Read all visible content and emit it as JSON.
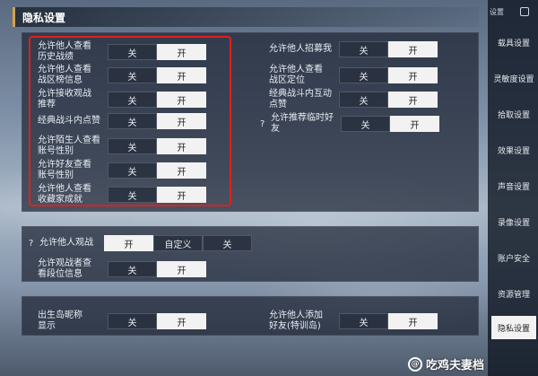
{
  "title": "隐私设置",
  "sidebar": {
    "header_label": "设置",
    "items": [
      {
        "label": "载具设置"
      },
      {
        "label": "灵敏度设置"
      },
      {
        "label": "拾取设置"
      },
      {
        "label": "效果设置"
      },
      {
        "label": "声音设置"
      },
      {
        "label": "录像设置"
      },
      {
        "label": "账户安全"
      },
      {
        "label": "资源管理"
      },
      {
        "label": "隐私设置",
        "active": true
      }
    ]
  },
  "toggle_labels": {
    "off": "关",
    "on": "开",
    "custom": "自定义"
  },
  "left_settings": [
    {
      "label": "允许他人查看历史战绩",
      "line1": "允许他人查看",
      "line2": "历史战绩",
      "value": "on"
    },
    {
      "label": "允许他人查看战区榜信息",
      "line1": "允许他人查看",
      "line2": "战区榜信息",
      "value": "on"
    },
    {
      "label": "允许接收观战推荐",
      "line1": "允许接收观战",
      "line2": "推荐",
      "value": "on"
    },
    {
      "label": "经典战斗内点赞",
      "line1": "经典战斗内点赞",
      "line2": "",
      "value": "on"
    },
    {
      "label": "允许陌生人查看账号性别",
      "line1": "允许陌生人查看",
      "line2": "账号性别",
      "value": "on"
    },
    {
      "label": "允许好友查看账号性别",
      "line1": "允许好友查看",
      "line2": "账号性别",
      "value": "on"
    },
    {
      "label": "允许他人查看收藏家成就",
      "line1": "允许他人查看",
      "line2": "收藏家成就",
      "value": "on"
    }
  ],
  "right_settings": [
    {
      "line1": "允许他人招募我",
      "line2": "",
      "value": "on"
    },
    {
      "line1": "允许他人查看",
      "line2": "战区定位",
      "value": "on"
    },
    {
      "line1": "经典战斗内互动",
      "line2": "点赞",
      "value": "on"
    },
    {
      "line1": "允许推荐临时好",
      "line2": "友",
      "value": "on",
      "help": "?"
    }
  ],
  "spectate": {
    "help": "?",
    "label": "允许他人观战",
    "options": [
      "开",
      "自定义",
      "关"
    ],
    "selected": "开"
  },
  "spectator_rank": {
    "line1": "允许观战者查",
    "line2": "看段位信息",
    "value": "on"
  },
  "birth_island": {
    "line1": "出生岛昵称",
    "line2": "显示",
    "value": "on"
  },
  "add_friend": {
    "line1": "允许他人添加",
    "line2": "好友(特训岛)",
    "value": "on"
  },
  "watermark": {
    "text": "吃鸡夫妻档",
    "icon": "@"
  },
  "colors": {
    "highlight": "#e0201c",
    "accent": "#d2a24c"
  }
}
